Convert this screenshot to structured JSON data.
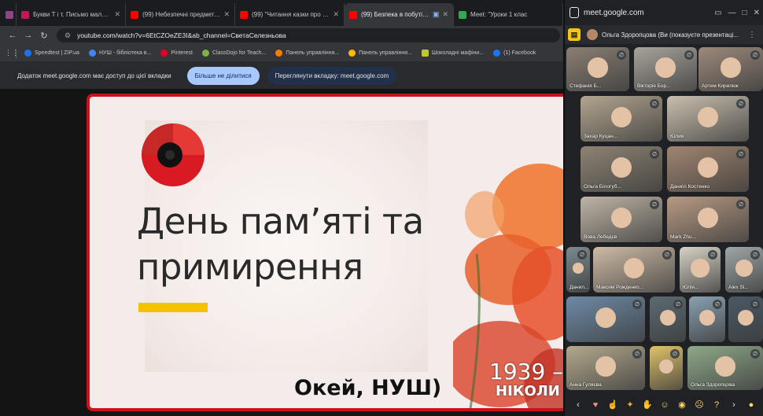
{
  "browser": {
    "tabs": [
      {
        "title": "",
        "icon": "meet-icon",
        "color": "#8e4585"
      },
      {
        "title": "Букви Т і т. Письмо малої бук",
        "icon": "pdf-icon",
        "color": "#c2185b"
      },
      {
        "title": "(99) Небезпечні предмети та",
        "icon": "youtube-icon",
        "color": "#ff0000"
      },
      {
        "title": "(99) \"Читання казки про черв",
        "icon": "youtube-icon",
        "color": "#ff0000"
      },
      {
        "title": "(99) Безпека в побуті. Пра",
        "icon": "youtube-icon",
        "color": "#ff0000"
      },
      {
        "title": "Meet: \"Уроки 1 клас",
        "icon": "meet-icon",
        "color": "#34a853"
      }
    ],
    "url": "youtube.com/watch?v=6EtCZOeZE3I&ab_channel=СветаСелезньова",
    "bookmarks": [
      {
        "label": "Speedtest | ZIP.ua",
        "color": "#1a73e8"
      },
      {
        "label": "НУШ - бібліотека в...",
        "color": "#4285f4"
      },
      {
        "label": "Pinterest",
        "color": "#e60023"
      },
      {
        "label": "ClassDojo for Teach...",
        "color": "#7cb342"
      },
      {
        "label": "Панель управління...",
        "color": "#f57c00"
      },
      {
        "label": "Панель управління...",
        "color": "#fbbc04"
      },
      {
        "label": "Шоколадні мафіни...",
        "color": "#c0ca33"
      },
      {
        "label": "(1) Facebook",
        "color": "#1877f2"
      }
    ],
    "sharebar": {
      "message": "Додаток meet.google.com має доступ до цієї вкладки",
      "stop_button": "Більше не ділитися",
      "switch_button": "Переглянути вкладку: meet.google.com"
    }
  },
  "slide": {
    "title_line1": "День пам’яті та",
    "title_line2": "примирення",
    "years": "1939 –",
    "never": "НІКОЛИ",
    "caption": "Окей, НУШ)",
    "accent": "#c7141b",
    "yellow": "#f3c300"
  },
  "meet": {
    "url": "meet.google.com",
    "presenter_text": "Ольга Здоропцова (Ви (показуєте презентаці...",
    "participants": [
      {
        "name": "Стефанія Б...",
        "color": "#8a7f74"
      },
      {
        "name": "Вікторія Бор...",
        "color": "#a8a49c"
      },
      {
        "name": "Артем Кирилюк",
        "color": "#9c8a7c"
      },
      {
        "name": "Захар Куцан...",
        "color": "#b3a58f"
      },
      {
        "name": "Юлия",
        "color": "#c9bfae"
      },
      {
        "name": "Ольга Білогуб...",
        "color": "#8d8373"
      },
      {
        "name": "Даниїл Костенко",
        "color": "#a08570"
      },
      {
        "name": "Вова Лебедєв",
        "color": "#bfb5a6"
      },
      {
        "name": "Mark Zhu...",
        "color": "#b79a83"
      },
      {
        "name": "Данил...",
        "color": "#7c8a8e"
      },
      {
        "name": "Максим Рожденко...",
        "color": "#cdbba6"
      },
      {
        "name": "Юлія...",
        "color": "#d6d2c6"
      },
      {
        "name": "Alex Sl...",
        "color": "#9fa6a6"
      },
      {
        "name": "",
        "color": "#6e8aa6"
      },
      {
        "name": "",
        "color": "#5b6b72"
      },
      {
        "name": "",
        "color": "#8aa0b0"
      },
      {
        "name": "",
        "color": "#4a5a66"
      },
      {
        "name": "Анна Гуляєва",
        "color": "#b3a98e"
      },
      {
        "name": "",
        "color": "#e0c26a"
      },
      {
        "name": "Ольга Здоропцова",
        "color": "#8fa88a"
      }
    ],
    "reactions": [
      "❤",
      "👍",
      "🎉",
      "👏",
      "😂",
      "😮",
      "😢",
      "🤔"
    ]
  }
}
